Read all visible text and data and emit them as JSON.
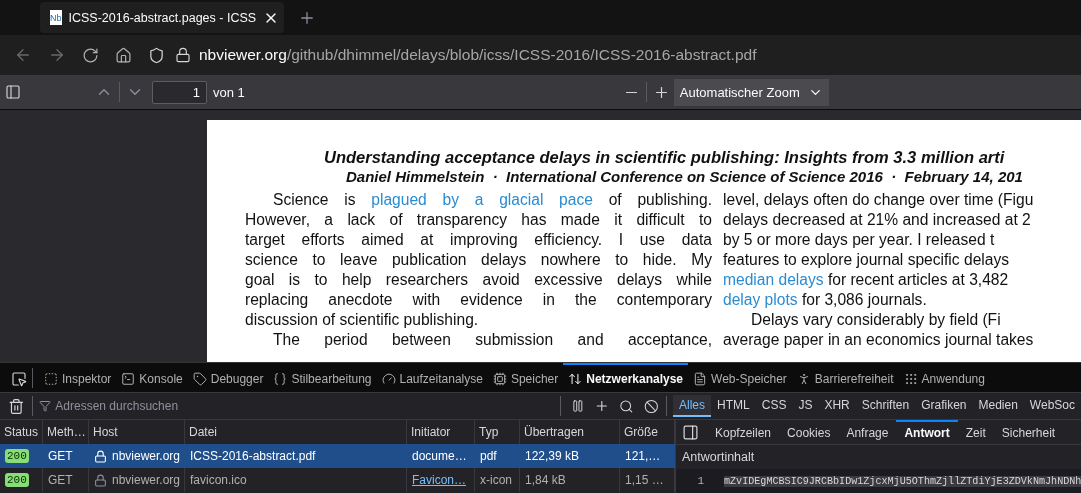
{
  "browser_tab": {
    "icon_text": "Nb",
    "title": "ICSS-2016-abstract.pages - ICSS"
  },
  "address_bar": {
    "domain": "nbviewer.org",
    "path": "/github/dhimmel/delays/blob/icss/ICSS-2016/ICSS-2016-abstract.pdf"
  },
  "pdf_toolbar": {
    "page": "1",
    "page_count": "von 1",
    "zoom": "Automatischer Zoom"
  },
  "document": {
    "title": "Understanding acceptance delays in scientific publishing: Insights from 3.3 million arti",
    "byline": "Daniel Himmelstein  ·  International Conference on Science of Science 2016  ·  February 14, 201",
    "columns": [
      {
        "clipped": false,
        "paragraphs": [
          {
            "indent": true,
            "lines": [
              [
                {
                  "text": "Science is "
                },
                {
                  "text": "plagued by a glacial pace",
                  "link": true
                },
                {
                  "text": " of publishing."
                }
              ],
              [
                {
                  "text": "However, a lack of transparency has made it difficult to"
                }
              ],
              [
                {
                  "text": "target efforts aimed at improving efficiency. I use data"
                }
              ],
              [
                {
                  "text": "science to leave publication delays nowhere to hide. My"
                }
              ],
              [
                {
                  "text": "goal is to help researchers avoid excessive delays while"
                }
              ],
              [
                {
                  "text": "replacing anecdote with evidence in the contemporary"
                }
              ],
              [
                {
                  "text": "discussion of scientific publishing."
                }
              ]
            ]
          },
          {
            "indent": true,
            "continues": true,
            "lines": [
              [
                {
                  "text": "The period between submission and acceptance,"
                }
              ]
            ]
          }
        ]
      },
      {
        "clipped": true,
        "paragraphs": [
          {
            "indent": false,
            "lines": [
              [
                {
                  "text": "level, delays often do change over time (Figu"
                }
              ],
              [
                {
                  "text": "delays decreased at 21% and increased at 2"
                }
              ],
              [
                {
                  "text": "by 5 or more days per year. I released t"
                }
              ],
              [
                {
                  "text": "features to explore journal specific delays"
                }
              ],
              [
                {
                  "text": "median delays",
                  "link": true
                },
                {
                  "text": " for recent articles at 3,482"
                }
              ],
              [
                {
                  "text": "delay plots",
                  "link": true
                },
                {
                  "text": " for 3,086 journals."
                }
              ]
            ]
          },
          {
            "indent": true,
            "lines": [
              [
                {
                  "text": "Delays vary considerably by field (Fi"
                }
              ],
              [
                {
                  "text": "average paper in an economics journal takes"
                }
              ]
            ]
          }
        ]
      }
    ]
  },
  "devtools": {
    "tabs": [
      {
        "label": "Inspektor",
        "selected": false
      },
      {
        "label": "Konsole",
        "selected": false
      },
      {
        "label": "Debugger",
        "selected": false
      },
      {
        "label": "Stilbearbeitung",
        "selected": false
      },
      {
        "label": "Laufzeitanalyse",
        "selected": false
      },
      {
        "label": "Speicher",
        "selected": false
      },
      {
        "label": "Netzwerkanalyse",
        "selected": true
      },
      {
        "label": "Web-Speicher",
        "selected": false
      },
      {
        "label": "Barrierefreiheit",
        "selected": false
      },
      {
        "label": "Anwendung",
        "selected": false
      }
    ],
    "filter": {
      "placeholder": "Adressen durchsuchen"
    },
    "type_filters": [
      {
        "label": "Alles",
        "selected": true
      },
      {
        "label": "HTML",
        "selected": false
      },
      {
        "label": "CSS",
        "selected": false
      },
      {
        "label": "JS",
        "selected": false
      },
      {
        "label": "XHR",
        "selected": false
      },
      {
        "label": "Schriften",
        "selected": false
      },
      {
        "label": "Grafiken",
        "selected": false
      },
      {
        "label": "Medien",
        "selected": false
      },
      {
        "label": "WebSoc",
        "selected": false
      }
    ],
    "table": {
      "columns": [
        "Status",
        "Meth…",
        "Host",
        "Datei",
        "Initiator",
        "Typ",
        "Übertragen",
        "Größe"
      ],
      "rows": [
        {
          "status": "200",
          "method": "GET",
          "host": "nbviewer.org",
          "file": "ICSS-2016-abstract.pdf",
          "initiator": "docume…",
          "initiator_link": false,
          "type": "pdf",
          "transferred": "122,39 kB",
          "size": "121,…",
          "selected": true
        },
        {
          "status": "200",
          "method": "GET",
          "host": "nbviewer.org",
          "file": "favicon.ico",
          "initiator": "Favicon…",
          "initiator_link": true,
          "type": "x-icon",
          "transferred": "1,84 kB",
          "size": "1,15 …",
          "selected": false
        }
      ]
    },
    "details": {
      "tabs": [
        {
          "label": "Kopfzeilen",
          "selected": false
        },
        {
          "label": "Cookies",
          "selected": false
        },
        {
          "label": "Anfrage",
          "selected": false
        },
        {
          "label": "Antwort",
          "selected": true
        },
        {
          "label": "Zeit",
          "selected": false
        },
        {
          "label": "Sicherheit",
          "selected": false
        }
      ],
      "section": "Antwortinhalt",
      "lines": [
        {
          "number": "1",
          "code": "mZvIDEgMCBSIC9JRCBbIDw1ZjcxMjU5OThmZjllZTdiYjE3ZDVkNmJhNDNh",
          "highlighted": true
        }
      ]
    }
  }
}
